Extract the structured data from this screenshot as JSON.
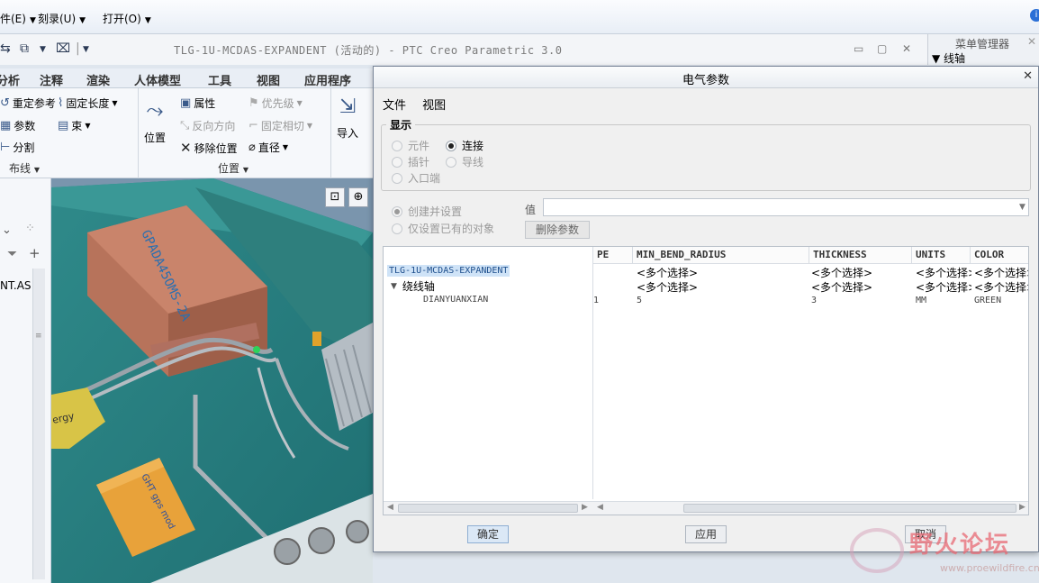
{
  "menubar": {
    "items": [
      "件(E)",
      "刻录(U)",
      "打开(O)"
    ]
  },
  "window": {
    "title": "TLG-1U-MCDAS-EXPANDENT (活动的) - PTC Creo Parametric 3.0"
  },
  "menu_manager": {
    "title": "菜单管理器",
    "item": "线轴"
  },
  "ribbon": {
    "tabs": [
      "分析",
      "注释",
      "渲染",
      "人体模型",
      "工具",
      "视图",
      "应用程序"
    ],
    "buttons": {
      "redefine_ref": "重定参考",
      "fixed_length": "固定长度",
      "params": "参数",
      "bundle": "束",
      "split": "分割",
      "position": "位置",
      "properties": "属性",
      "priority": "优先级",
      "reverse": "反向方向",
      "fixed_tangent": "固定相切",
      "remove_position": "移除位置",
      "diameter": "直径",
      "import": "导入"
    },
    "groups": {
      "routing": "布线",
      "position": "位置"
    }
  },
  "left_panel": {
    "label": "NT.AS"
  },
  "viewport": {
    "box_text": "GPADA45OMS-2A",
    "yellow_text": "ergy",
    "module_text": "GHT gps mod"
  },
  "dialog": {
    "title": "电气参数",
    "menu": [
      "文件",
      "视图"
    ],
    "display_group": "显示",
    "radios": {
      "component": "元件",
      "connection": "连接",
      "pin": "插针",
      "wire": "导线",
      "entry_port": "入口端",
      "create_set": "创建并设置",
      "set_existing": "仅设置已有的对象"
    },
    "value_label": "值",
    "value_input": "",
    "delete_button": "删除参数",
    "columns": [
      "PE",
      "MIN_BEND_RADIUS",
      "THICKNESS",
      "UNITS",
      "COLOR"
    ],
    "tree": {
      "root": "TLG-1U-MCDAS-EXPANDENT",
      "spool": "绕线轴",
      "item": "DIANYUANXIAN"
    },
    "rows": [
      {
        "pe": "",
        "min_bend_radius": "<多个选择>",
        "thickness": "<多个选择>",
        "units": "<多个选择>",
        "color": "<多个选择>"
      },
      {
        "pe": "",
        "min_bend_radius": "<多个选择>",
        "thickness": "<多个选择>",
        "units": "<多个选择>",
        "color": "<多个选择>"
      },
      {
        "pe": "1",
        "min_bend_radius": "5",
        "thickness": "3",
        "units": "MM",
        "color": "GREEN"
      }
    ],
    "buttons": {
      "ok": "确定",
      "apply": "应用",
      "cancel": "取消"
    }
  },
  "watermark": {
    "text": "野火论坛",
    "url": "www.proewildfire.cn"
  }
}
